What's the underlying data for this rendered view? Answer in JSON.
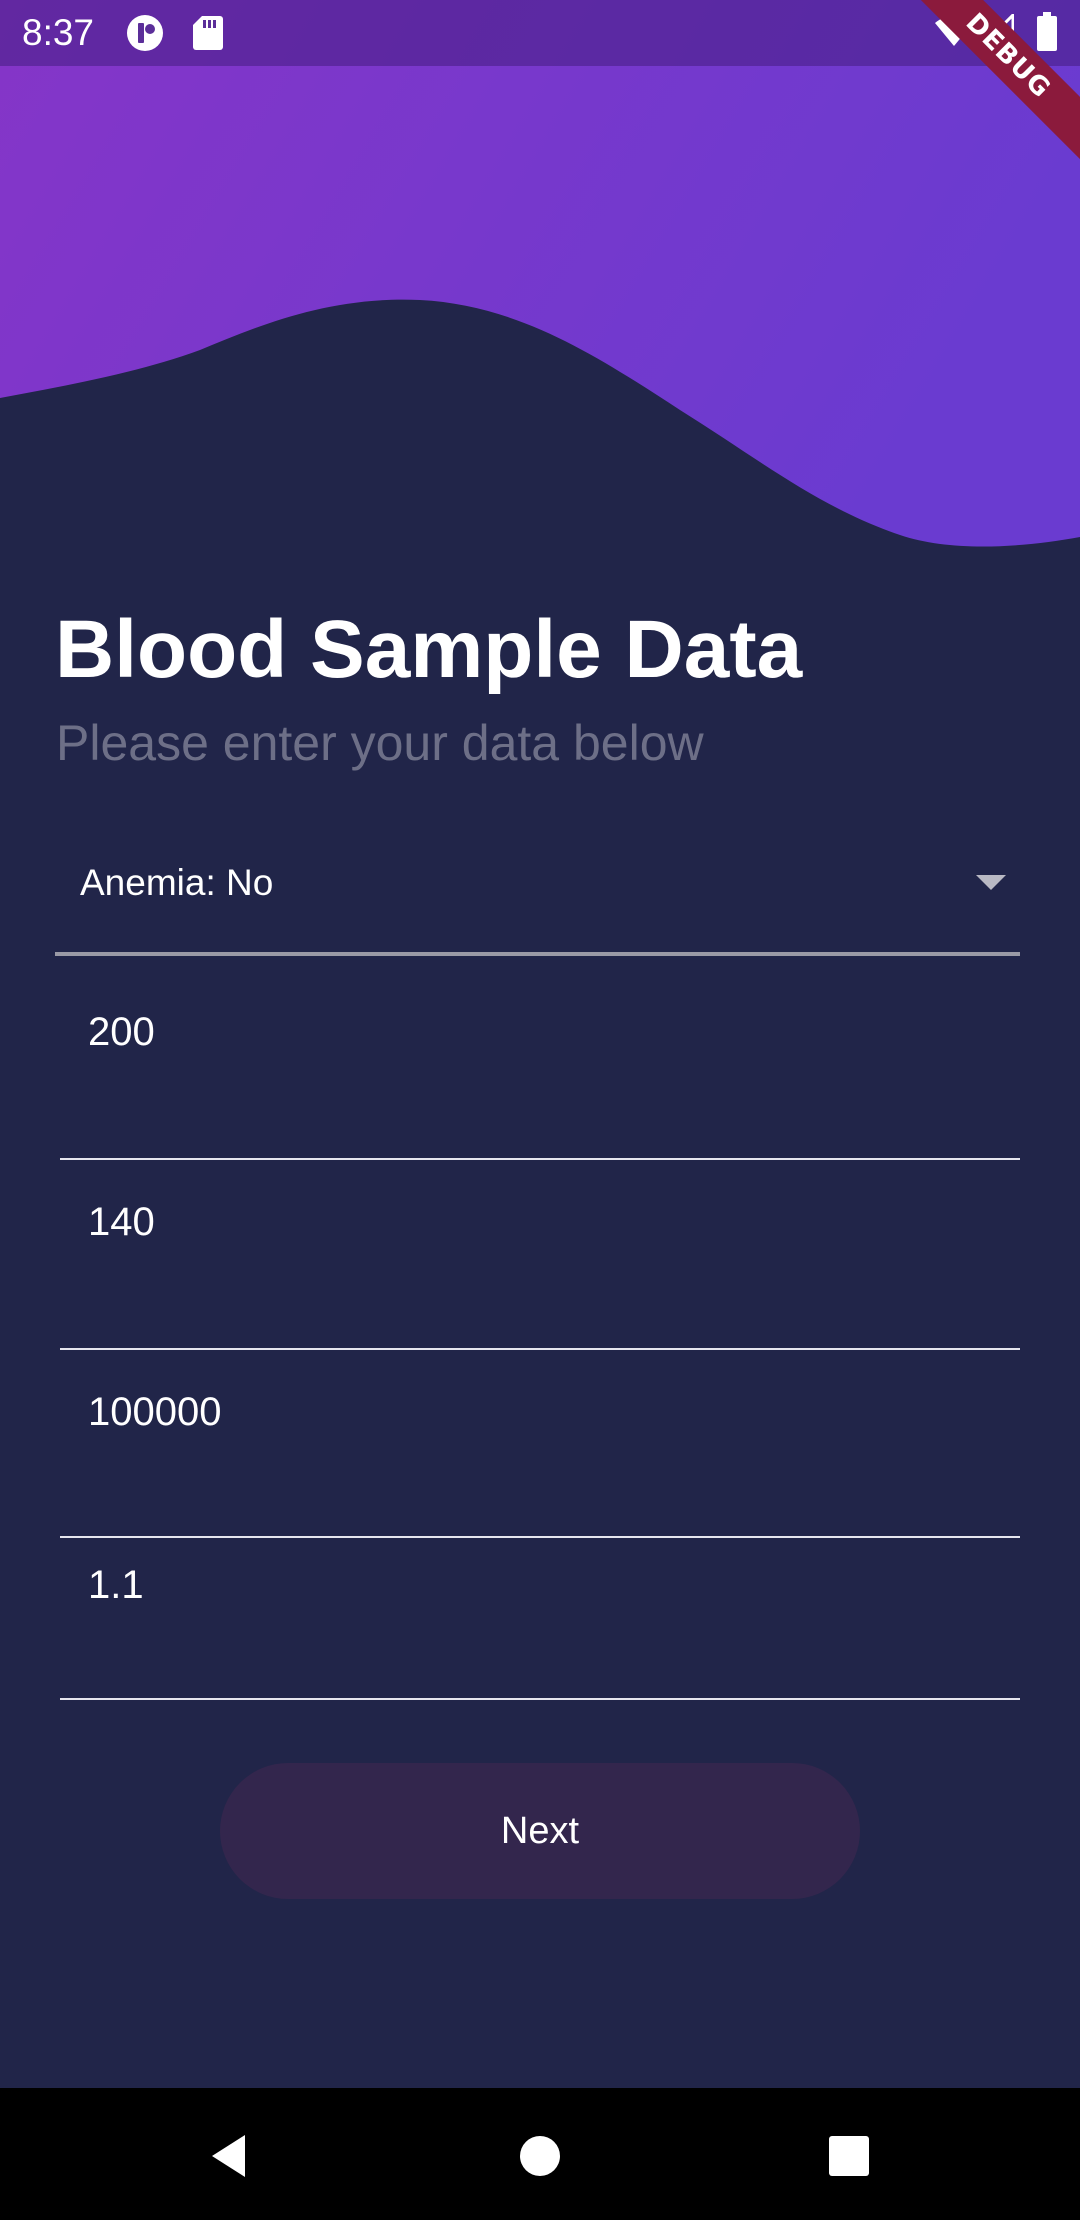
{
  "status_bar": {
    "time": "8:37",
    "left_icons": [
      "app-notification-icon",
      "sd-card-icon"
    ],
    "right_icons": [
      "wifi-icon",
      "cell-signal-icon",
      "battery-icon"
    ]
  },
  "debug_banner": {
    "label": "DEBUG",
    "color": "#8b1a3c"
  },
  "header": {
    "gradient_start": "#8535c8",
    "gradient_end": "#6a3bd0"
  },
  "form": {
    "title": "Blood Sample Data",
    "subtitle": "Please enter your data below",
    "anemia_dropdown": {
      "selected": "Anemia: No"
    },
    "fields": [
      {
        "value": "200"
      },
      {
        "value": "140"
      },
      {
        "value": "100000"
      },
      {
        "value": "1.1"
      }
    ],
    "next_label": "Next"
  },
  "nav_bar": {
    "buttons": [
      "back-icon",
      "home-icon",
      "recents-icon"
    ]
  },
  "colors": {
    "background": "#212549",
    "button": "#33264d",
    "subtitle": "#6d6f87"
  }
}
